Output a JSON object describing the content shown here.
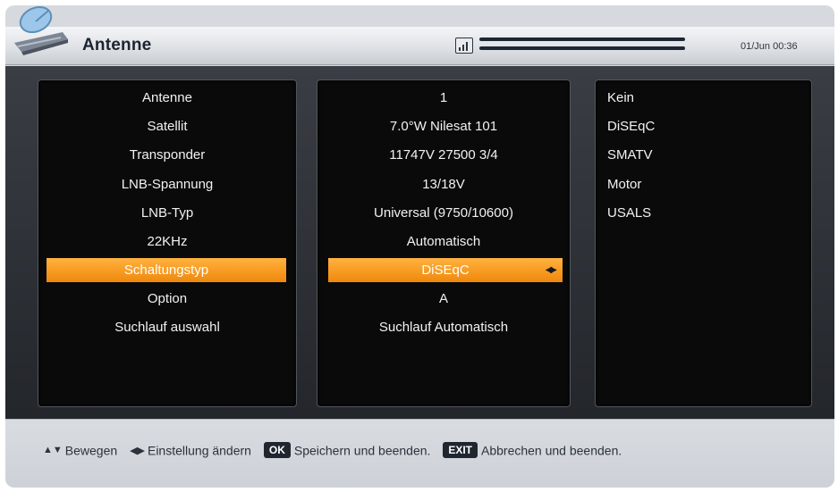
{
  "header": {
    "title": "Antenne",
    "datetime": "01/Jun 00:36"
  },
  "labels": [
    "Antenne",
    "Satellit",
    "Transponder",
    "LNB-Spannung",
    "LNB-Typ",
    "22KHz",
    "Schaltungstyp",
    "Option",
    "Suchlauf auswahl"
  ],
  "values": [
    "1",
    "7.0°W Nilesat 101",
    "11747V 27500 3/4",
    "13/18V",
    "Universal (9750/10600)",
    "Automatisch",
    "DiSEqC",
    "A",
    "Suchlauf Automatisch"
  ],
  "options": [
    "Kein",
    "DiSEqC",
    "SMATV",
    "Motor",
    "USALS"
  ],
  "selected_index": 6,
  "footer": {
    "move": "Bewegen",
    "change": "Einstellung ändern",
    "ok_key": "OK",
    "save": "Speichern und beenden.",
    "exit_key": "EXIT",
    "cancel": "Abbrechen und beenden."
  },
  "colors": {
    "highlight": "#f7a12a",
    "panel": "#0a0a0b",
    "text": "#f2f2f2"
  },
  "icons": [
    "satellite-dish-icon",
    "signal-icon",
    "up-down-arrows-icon",
    "left-right-arrows-icon"
  ]
}
